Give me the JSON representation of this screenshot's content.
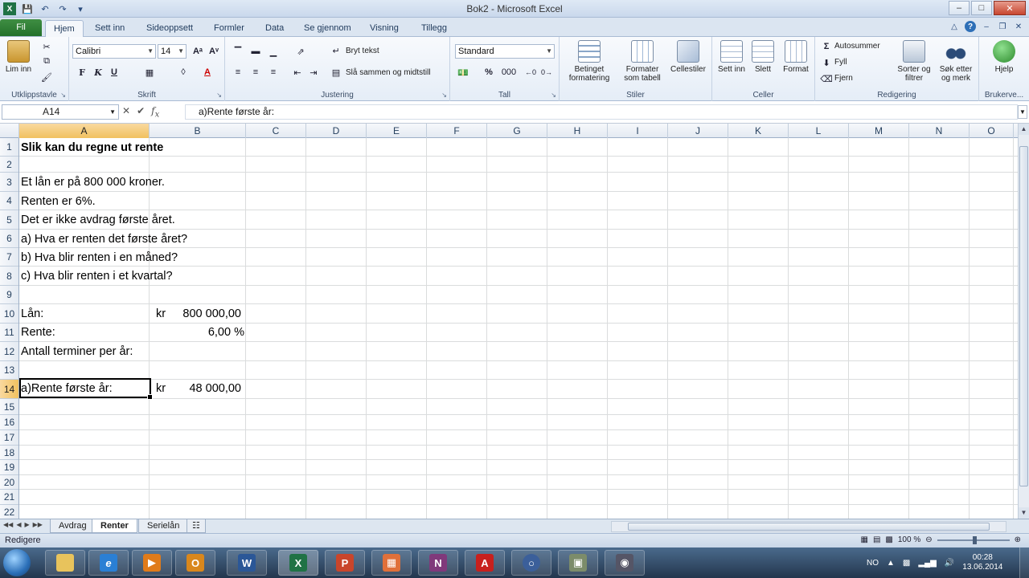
{
  "window": {
    "title": "Bok2 - Microsoft Excel"
  },
  "ribbon_tabs": [
    {
      "label": "Fil"
    },
    {
      "label": "Hjem"
    },
    {
      "label": "Sett inn"
    },
    {
      "label": "Sideoppsett"
    },
    {
      "label": "Formler"
    },
    {
      "label": "Data"
    },
    {
      "label": "Se gjennom"
    },
    {
      "label": "Visning"
    },
    {
      "label": "Tillegg"
    }
  ],
  "ribbon": {
    "clipboard": {
      "paste_label": "Lim inn",
      "group_label": "Utklippstavle"
    },
    "font": {
      "font_name": "Calibri",
      "font_size": "14",
      "group_label": "Skrift",
      "bold": "F",
      "italic": "K",
      "underline": "U"
    },
    "alignment": {
      "wrap_text": "Bryt tekst",
      "merge_center": "Slå sammen og midtstill",
      "group_label": "Justering"
    },
    "number": {
      "format": "Standard",
      "percent": "%",
      "thousands": "000",
      "group_label": "Tall"
    },
    "styles": {
      "conditional": "Betinget formatering",
      "format_table": "Formater som tabell",
      "cell_styles": "Cellestiler",
      "group_label": "Stiler"
    },
    "cells": {
      "insert": "Sett inn",
      "delete": "Slett",
      "format": "Format",
      "group_label": "Celler"
    },
    "editing": {
      "autosum": "Autosummer",
      "fill": "Fyll",
      "clear": "Fjern",
      "sort_filter": "Sorter og filtrer",
      "find_select": "Søk etter og merk",
      "group_label": "Redigering"
    },
    "help": {
      "label": "Hjelp",
      "group_label": "Brukerve..."
    }
  },
  "formula_bar": {
    "name_box": "A14",
    "formula": "a)Rente første år:"
  },
  "columns": [
    "A",
    "B",
    "C",
    "D",
    "E",
    "F",
    "G",
    "H",
    "I",
    "J",
    "K",
    "L",
    "M",
    "N",
    "O"
  ],
  "rows": [
    "1",
    "2",
    "3",
    "4",
    "5",
    "6",
    "7",
    "8",
    "9",
    "10",
    "11",
    "12",
    "13",
    "14",
    "15",
    "16",
    "17",
    "18",
    "19",
    "20",
    "21",
    "22"
  ],
  "cells": {
    "A1": "Slik kan du regne ut rente",
    "A3": "Et lån er på 800 000 kroner.",
    "A4": "Renten er 6%.",
    "A5": "Det er ikke avdrag første året.",
    "A6": "a) Hva er renten det første året?",
    "A7": "b) Hva blir renten i en måned?",
    "A8": "c) Hva blir renten i et kvartal?",
    "A10": "Lån:",
    "B10_cur": "kr",
    "B10_val": "800 000,00",
    "A11": "Rente:",
    "B11": "6,00 %",
    "A12": "Antall terminer per år:",
    "A14": "a)Rente første år:",
    "B14_cur": "kr",
    "B14_val": "48 000,00"
  },
  "sheet_tabs": [
    {
      "label": "Avdrag"
    },
    {
      "label": "Renter"
    },
    {
      "label": "Serielån"
    }
  ],
  "status": {
    "text": "Redigere",
    "zoom": "100 %"
  },
  "taskbar": {
    "language": "NO",
    "time": "00:28",
    "date": "13.06.2014"
  }
}
